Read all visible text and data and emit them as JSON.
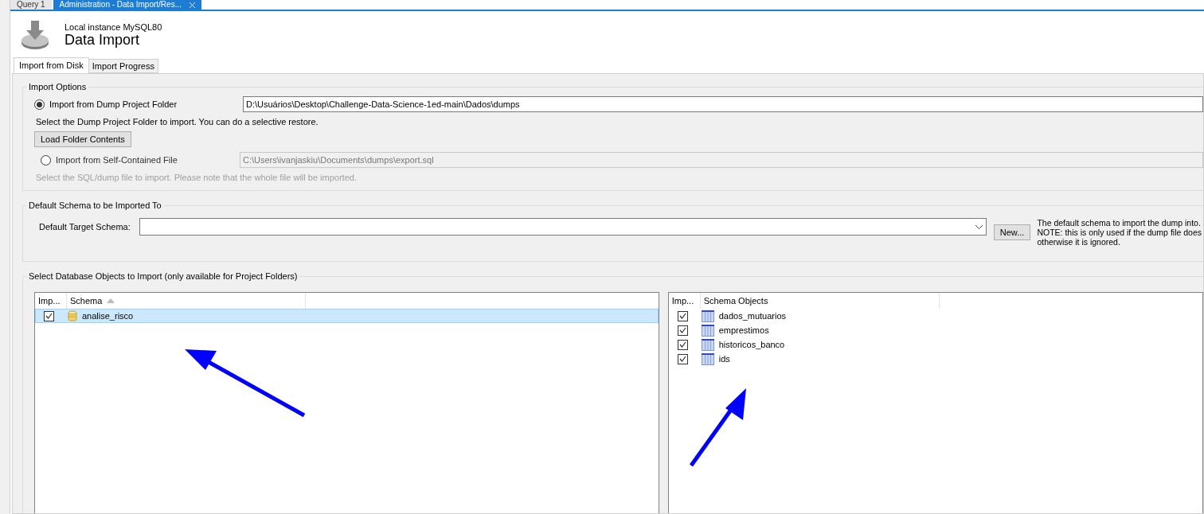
{
  "editor_tabs": [
    {
      "label": "Query 1",
      "selected": false,
      "closable": false
    },
    {
      "label": "Administration - Data Import/Res...",
      "selected": true,
      "closable": true
    }
  ],
  "header": {
    "subtitle": "Local instance MySQL80",
    "title": "Data Import"
  },
  "tabs": [
    {
      "label": "Import from Disk",
      "selected": true
    },
    {
      "label": "Import Progress",
      "selected": false
    }
  ],
  "import_options": {
    "title": "Import Options",
    "options": [
      {
        "label": "Import from Dump Project Folder",
        "selected": true,
        "disabled": false,
        "path": "D:\\Usuários\\Desktop\\Challenge-Data-Science-1ed-main\\Dados\\dumps",
        "hint": "Select the Dump Project Folder to import. You can do a selective restore.",
        "button": "Load Folder Contents"
      },
      {
        "label": "Import from Self-Contained File",
        "selected": false,
        "disabled": true,
        "path": "C:\\Users\\ivanjaskiu\\Documents\\dumps\\export.sql",
        "hint": "Select the SQL/dump file to import. Please note that the whole file will be imported."
      }
    ]
  },
  "default_schema": {
    "title": "Default Schema to be Imported To",
    "label": "Default Target Schema:",
    "new_button": "New...",
    "note": [
      "The default schema to import the dump into.",
      "NOTE: this is only used if the dump file does",
      "otherwise it is ignored."
    ]
  },
  "objects": {
    "title": "Select Database Objects to Import (only available for Project Folders)",
    "schemas": {
      "columns": [
        "Imp...",
        "Schema"
      ],
      "rows": [
        {
          "name": "analise_risco",
          "checked": true,
          "selected": true
        }
      ]
    },
    "schema_objects": {
      "columns": [
        "Imp...",
        "Schema Objects"
      ],
      "rows": [
        {
          "name": "dados_mutuarios",
          "checked": true,
          "selected": false
        },
        {
          "name": "emprestimos",
          "checked": true,
          "selected": false
        },
        {
          "name": "historicos_banco",
          "checked": true,
          "selected": false
        },
        {
          "name": "ids",
          "checked": true,
          "selected": false
        }
      ]
    }
  }
}
